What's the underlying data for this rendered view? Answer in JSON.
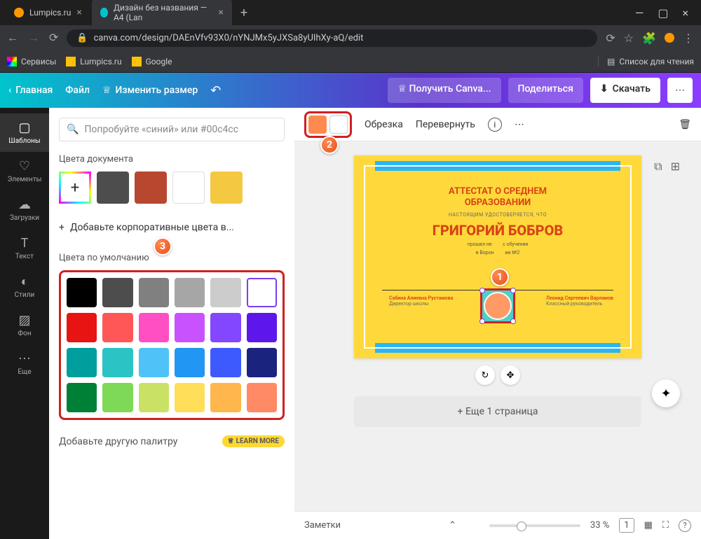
{
  "browser": {
    "tabs": [
      {
        "title": "Lumpics.ru",
        "active": false
      },
      {
        "title": "Дизайн без названия — A4 (Lan",
        "active": true
      }
    ],
    "url": "canva.com/design/DAEnVfv93X0/nYNJMx5yJXSa8yUIhXy-aQ/edit",
    "bookmarks": {
      "services": "Сервисы",
      "lumpics": "Lumpics.ru",
      "google": "Google",
      "reading": "Список для чтения"
    }
  },
  "canva": {
    "home": "Главная",
    "file": "Файл",
    "resize": "Изменить размер",
    "get_pro": "Получить Canva...",
    "share": "Поделиться",
    "download": "Скачать"
  },
  "sidebar": [
    {
      "icon": "▢",
      "label": "Шаблоны"
    },
    {
      "icon": "♡",
      "label": "Элементы"
    },
    {
      "icon": "☁",
      "label": "Загрузки"
    },
    {
      "icon": "T",
      "label": "Текст"
    },
    {
      "icon": "◐",
      "label": "Стили"
    },
    {
      "icon": "▨",
      "label": "Фон"
    },
    {
      "icon": "⋯",
      "label": "Еще"
    }
  ],
  "panel": {
    "search_placeholder": "Попробуйте «синий» или #00c4cc",
    "doc_colors_title": "Цвета документа",
    "doc_colors": [
      "#4d4d4d",
      "#b8472f",
      "#ffffff",
      "#f5c842"
    ],
    "add_brand": "Добавьте корпоративные цвета в...",
    "default_title": "Цвета по умолчанию",
    "default_colors": [
      "#000000",
      "#4d4d4d",
      "#808080",
      "#a6a6a6",
      "#cccccc",
      "#ffffff",
      "#e81313",
      "#ff5757",
      "#ff4fc3",
      "#c952ff",
      "#8247ff",
      "#5e17eb",
      "#019e9e",
      "#2bc4c4",
      "#4fc3f7",
      "#2196f3",
      "#3d5afe",
      "#1a237e",
      "#008037",
      "#7ed957",
      "#c9e265",
      "#ffde59",
      "#ffb74d",
      "#ff8a65"
    ],
    "another_palette": "Добавьте другую палитру",
    "learn_more": "LEARN MORE"
  },
  "toolbar": {
    "crop": "Обрезка",
    "flip": "Перевернуть"
  },
  "certificate": {
    "title1": "АТТЕСТАТ О СРЕДНЕМ",
    "title2": "ОБРАЗОВАНИИ",
    "subtitle": "НАСТОЯЩИМ УДОСТОВЕРЯЕТСЯ, ЧТО",
    "name": "ГРИГОРИЙ БОБРОВ",
    "line1": "прошел не",
    "line1b": "с обучения",
    "line2": "в Ворон",
    "line2b": "ии №2",
    "sig_left": "Сабина Алиевна Рустамова",
    "sig_left_role": "Директор школы",
    "sig_right": "Леонид Сергеевич Варламов",
    "sig_right_role": "Классный руководитель"
  },
  "add_page": "+ Еще 1 страница",
  "bottom": {
    "notes": "Заметки",
    "zoom": "33 %",
    "page": "1"
  },
  "badges": [
    "1",
    "2",
    "3"
  ]
}
